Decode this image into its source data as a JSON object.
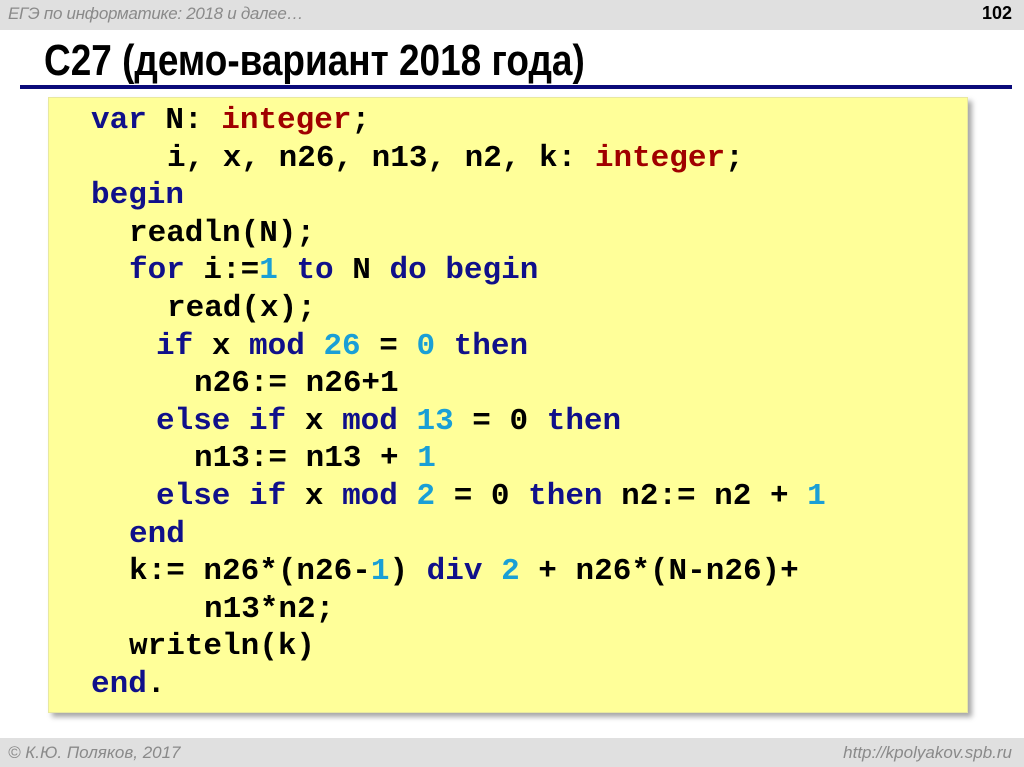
{
  "header": {
    "course": "ЕГЭ по информатике: 2018 и далее…",
    "page_number": "102"
  },
  "title": "С27 (демо-вариант 2018 года)",
  "code": {
    "lines": [
      [
        {
          "t": "var",
          "k": "k"
        },
        {
          "t": " N: "
        },
        {
          "t": "integer",
          "k": "t"
        },
        {
          "t": ";"
        }
      ],
      [
        {
          "t": "i, x, n26, n13, n2, k: "
        },
        {
          "t": "integer",
          "k": "t"
        },
        {
          "t": ";"
        }
      ],
      [
        {
          "t": "begin",
          "k": "k"
        }
      ],
      [
        {
          "t": "readln(N);"
        }
      ],
      [
        {
          "t": "for",
          "k": "k"
        },
        {
          "t": " i:="
        },
        {
          "t": "1",
          "k": "n"
        },
        {
          "t": " "
        },
        {
          "t": "to",
          "k": "k"
        },
        {
          "t": " N "
        },
        {
          "t": "do",
          "k": "k"
        },
        {
          "t": " "
        },
        {
          "t": "begin",
          "k": "k"
        }
      ],
      [
        {
          "t": "read(x);"
        }
      ],
      [
        {
          "t": "if",
          "k": "k"
        },
        {
          "t": " x "
        },
        {
          "t": "mod",
          "k": "k"
        },
        {
          "t": " "
        },
        {
          "t": "26",
          "k": "n"
        },
        {
          "t": " = "
        },
        {
          "t": "0",
          "k": "n"
        },
        {
          "t": " "
        },
        {
          "t": "then",
          "k": "k"
        }
      ],
      [
        {
          "t": "n26:= n26+1"
        }
      ],
      [
        {
          "t": "else",
          "k": "k"
        },
        {
          "t": " "
        },
        {
          "t": "if",
          "k": "k"
        },
        {
          "t": " x "
        },
        {
          "t": "mod",
          "k": "k"
        },
        {
          "t": " "
        },
        {
          "t": "13",
          "k": "n"
        },
        {
          "t": " = 0 "
        },
        {
          "t": "then",
          "k": "k"
        }
      ],
      [
        {
          "t": "n13:= n13 + "
        },
        {
          "t": "1",
          "k": "n"
        }
      ],
      [
        {
          "t": "else",
          "k": "k"
        },
        {
          "t": " "
        },
        {
          "t": "if",
          "k": "k"
        },
        {
          "t": " x "
        },
        {
          "t": "mod",
          "k": "k"
        },
        {
          "t": " "
        },
        {
          "t": "2",
          "k": "n"
        },
        {
          "t": " = 0 "
        },
        {
          "t": "then",
          "k": "k"
        },
        {
          "t": " n2:= n2 + "
        },
        {
          "t": "1",
          "k": "n"
        }
      ],
      [
        {
          "t": "end",
          "k": "k"
        }
      ],
      [
        {
          "t": "k:= n26*(n26-"
        },
        {
          "t": "1",
          "k": "n"
        },
        {
          "t": ") "
        },
        {
          "t": "div",
          "k": "k"
        },
        {
          "t": " "
        },
        {
          "t": "2",
          "k": "n"
        },
        {
          "t": " + n26*(N-n26)+"
        }
      ],
      [
        {
          "t": "n13*n2;"
        }
      ],
      [
        {
          "t": "writeln(k)"
        }
      ],
      [
        {
          "t": "end",
          "k": "k"
        },
        {
          "t": "."
        }
      ]
    ]
  },
  "footer": {
    "author": "© К.Ю. Поляков, 2017",
    "url": "http://kpolyakov.spb.ru"
  },
  "colors": {
    "keyword": "#10108a",
    "number": "#1a9fd6",
    "type": "#a00000",
    "code_background": "#ffff99",
    "rule": "#0a0a7a"
  }
}
